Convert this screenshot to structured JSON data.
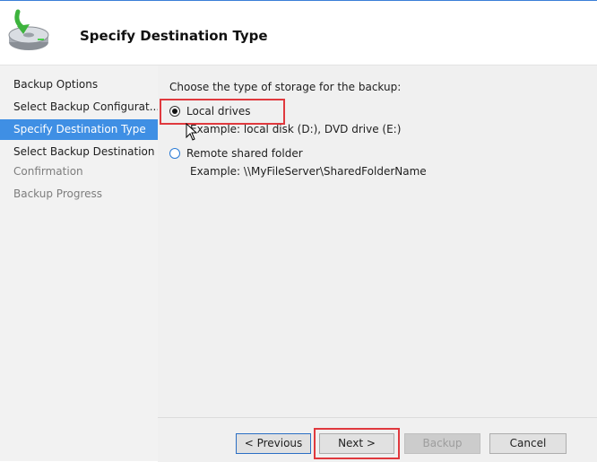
{
  "header": {
    "title": "Specify Destination Type",
    "icon": "backup-drive-icon"
  },
  "sidebar": {
    "items": [
      {
        "label": "Backup Options",
        "state": "normal"
      },
      {
        "label": "Select Backup Configurat...",
        "state": "normal"
      },
      {
        "label": "Specify Destination Type",
        "state": "active"
      },
      {
        "label": "Select Backup Destination",
        "state": "normal"
      },
      {
        "label": "Confirmation",
        "state": "disabled"
      },
      {
        "label": "Backup Progress",
        "state": "disabled"
      }
    ]
  },
  "main": {
    "prompt": "Choose the type of storage for the backup:",
    "options": [
      {
        "label": "Local drives",
        "example": "Example: local disk (D:), DVD drive (E:)",
        "selected": true
      },
      {
        "label": "Remote shared folder",
        "example": "Example: \\\\MyFileServer\\SharedFolderName",
        "selected": false
      }
    ]
  },
  "footer": {
    "previous_label": "< Previous",
    "next_label": "Next >",
    "backup_label": "Backup",
    "cancel_label": "Cancel"
  },
  "colors": {
    "accent": "#3f8fe4",
    "highlight": "#e0393e"
  }
}
